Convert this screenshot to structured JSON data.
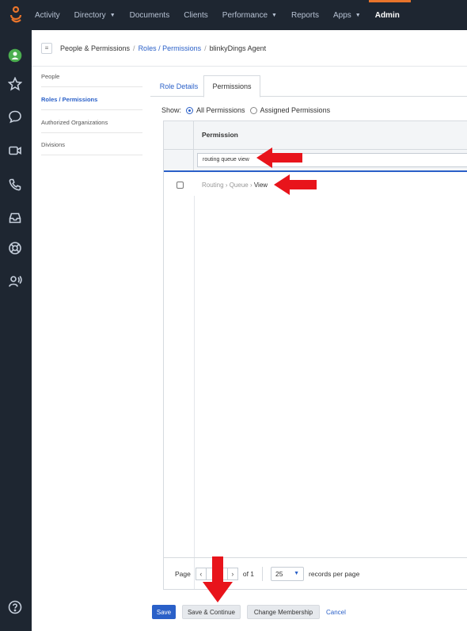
{
  "topnav": {
    "items": [
      {
        "label": "Activity",
        "caret": false
      },
      {
        "label": "Directory",
        "caret": true
      },
      {
        "label": "Documents",
        "caret": false
      },
      {
        "label": "Clients",
        "caret": false
      },
      {
        "label": "Performance",
        "caret": true
      },
      {
        "label": "Reports",
        "caret": false
      },
      {
        "label": "Apps",
        "caret": true
      },
      {
        "label": "Admin",
        "caret": false
      }
    ],
    "active": "Admin",
    "accent": "#e8742b"
  },
  "rail": {
    "icons": [
      "status-dot-icon",
      "star-icon",
      "chat-icon",
      "video-icon",
      "phone-icon",
      "inbox-icon",
      "help-ring-icon",
      "voice-user-icon",
      "help-icon"
    ]
  },
  "breadcrumb": {
    "section": "People & Permissions",
    "link": "Roles / Permissions",
    "current": "blinkyDings Agent"
  },
  "sidebar": {
    "items": [
      {
        "label": "People"
      },
      {
        "label": "Roles / Permissions"
      },
      {
        "label": "Authorized Organizations"
      },
      {
        "label": "Divisions"
      }
    ]
  },
  "tabs": {
    "role_details": "Role Details",
    "permissions": "Permissions"
  },
  "show": {
    "label": "Show:",
    "all": "All Permissions",
    "assigned": "Assigned Permissions"
  },
  "table": {
    "header": "Permission",
    "filter_value": "routing queue view",
    "row": {
      "part1": "Routing",
      "part2": "Queue",
      "part3": "View"
    }
  },
  "pager": {
    "page_label": "Page",
    "page_value": "1",
    "of_label": "of 1",
    "page_size": "25",
    "records_label": "records per page"
  },
  "actions": {
    "save": "Save",
    "save_continue": "Save & Continue",
    "change_membership": "Change Membership",
    "cancel": "Cancel"
  },
  "colors": {
    "nav_bg": "#1e2631",
    "link": "#2a60c8",
    "arrow": "#e8141b"
  }
}
